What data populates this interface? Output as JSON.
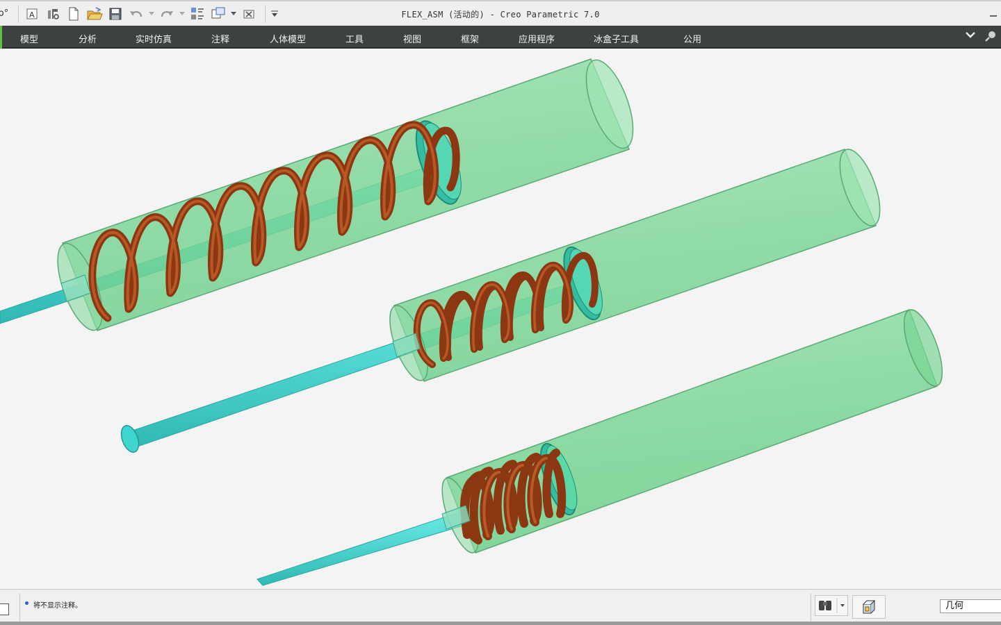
{
  "window": {
    "title": "FLEX_ASM (活动的) - Creo Parametric 7.0"
  },
  "qat": {
    "overflow_glyph": "o°"
  },
  "ribbon": {
    "tabs": [
      {
        "label": "模型"
      },
      {
        "label": "分析"
      },
      {
        "label": "实时仿真"
      },
      {
        "label": "注释"
      },
      {
        "label": "人体模型"
      },
      {
        "label": "工具"
      },
      {
        "label": "视图"
      },
      {
        "label": "框架"
      },
      {
        "label": "应用程序"
      },
      {
        "label": "冰盒子工具"
      },
      {
        "label": "公用"
      }
    ]
  },
  "status": {
    "message": "将不显示注释。",
    "filter_value": "几何"
  },
  "colors": {
    "ribbon_bg": "#3d4141",
    "tube_fill": "#7fd89a",
    "tube_stroke": "#5aa975",
    "rod": "#3fd6cf",
    "spring": "#a5471a",
    "cap": "#36bfa3"
  }
}
